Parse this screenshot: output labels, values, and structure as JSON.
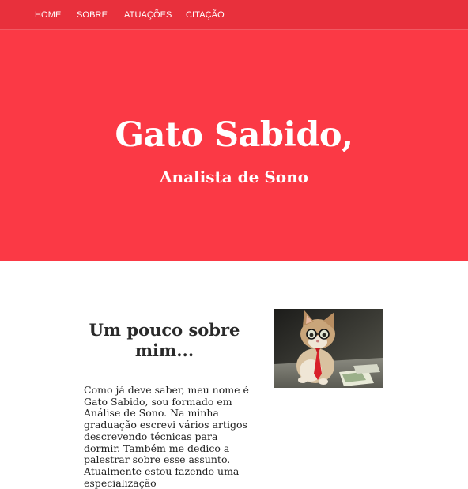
{
  "nav": {
    "items": [
      {
        "label": "HOME"
      },
      {
        "label": "SOBRE"
      },
      {
        "label": "ATUAÇÕES"
      },
      {
        "label": "CITAÇÃO"
      }
    ]
  },
  "hero": {
    "title": "Gato Sabido,",
    "subtitle": "Analista de Sono"
  },
  "about": {
    "heading": "Um pouco sobre mim...",
    "text": "Como já deve saber, meu nome é Gato Sabido, sou formado em Análise de Sono. Na minha graduação escrevi vários artigos descrevendo técnicas para dormir. Também me dedico a palestrar sobre esse assunto. Atualmente estou fazendo uma especialização"
  },
  "colors": {
    "nav_bg": "#e8303c",
    "hero_bg": "#fb3945",
    "text_dark": "#2a2a2a"
  }
}
